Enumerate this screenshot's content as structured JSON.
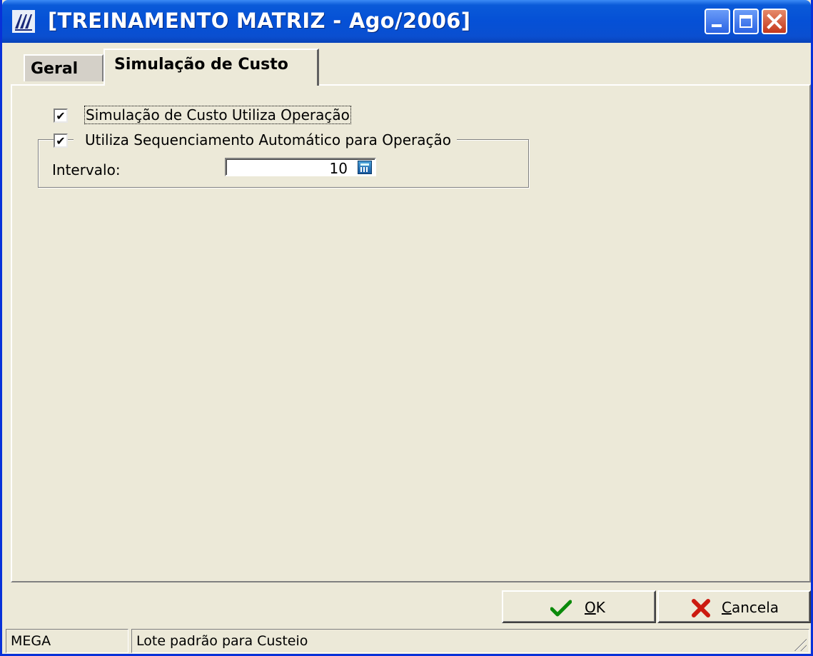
{
  "window": {
    "title": "[TREINAMENTO MATRIZ - Ago/2006]"
  },
  "tabs": [
    {
      "label": "Geral",
      "active": false
    },
    {
      "label": "Simulação de Custo",
      "active": true
    }
  ],
  "options": {
    "simulacao_utiliza_operacao": {
      "label": "Simulação de Custo Utiliza Operação",
      "checked": true
    },
    "sequenciamento_automatico": {
      "label": "Utiliza Sequenciamento Automático para Operação",
      "checked": true
    }
  },
  "intervalo": {
    "label": "Intervalo:",
    "value": "10"
  },
  "buttons": {
    "ok": {
      "mnemonic": "O",
      "rest": "K"
    },
    "cancel": {
      "mnemonic": "C",
      "rest": "ancela"
    }
  },
  "statusbar": {
    "company": "MEGA",
    "message": "Lote padrão para Custeio"
  },
  "colors": {
    "titlebar": "#0550d6",
    "window_bg": "#ece9d8",
    "ok_icon": "#0a8a0a",
    "cancel_icon": "#cc1a10"
  },
  "icons": {
    "app": "mega-logo-icon",
    "ok": "checkmark-icon",
    "cancel": "x-icon",
    "calculator": "calculator-icon"
  }
}
